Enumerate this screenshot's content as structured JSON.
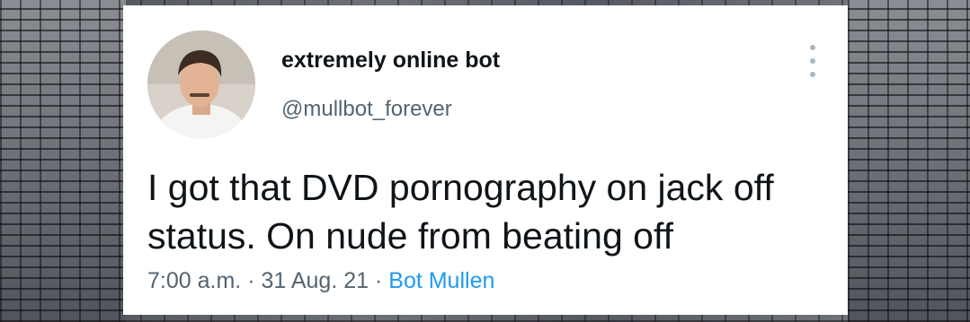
{
  "tweet": {
    "display_name": "extremely online bot",
    "handle": "@mullbot_forever",
    "text": "I got that DVD pornography on jack off status. On nude from beating off",
    "time": "7:00 a.m.",
    "separator": "·",
    "date": "31 Aug. 21",
    "source": "Bot Mullen"
  },
  "icons": {
    "more": "more-vertical-icon"
  },
  "colors": {
    "card_bg": "#ffffff",
    "name": "#0f1419",
    "secondary": "#536471",
    "link": "#1d9bf0"
  }
}
